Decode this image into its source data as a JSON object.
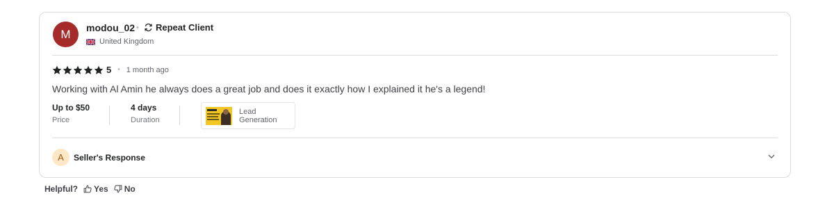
{
  "reviewer": {
    "avatar_initial": "M",
    "avatar_color": "#a52a2a",
    "username": "modou_02",
    "badge_icon": "repeat-icon",
    "badge_label": "Repeat Client",
    "country_flag": "uk-flag-icon",
    "country": "United Kingdom"
  },
  "review": {
    "stars": 5,
    "rating": "5",
    "time_ago": "1 month ago",
    "text": "Working with Al Amin he always does a great job and does it exactly how I explained it he's a legend!"
  },
  "details": {
    "price_value": "Up to $50",
    "price_label": "Price",
    "duration_value": "4 days",
    "duration_label": "Duration",
    "gig_title": "Lead Generation"
  },
  "seller_response": {
    "avatar_initial": "A",
    "label": "Seller's Response"
  },
  "helpful": {
    "question": "Helpful?",
    "yes": "Yes",
    "no": "No"
  }
}
